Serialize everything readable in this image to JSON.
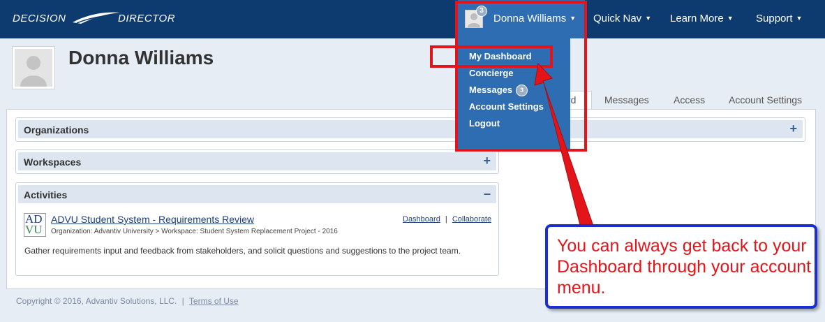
{
  "navbar": {
    "logo_left": "DECISION",
    "logo_right": "DIRECTOR",
    "user": {
      "name": "Donna Williams",
      "badge": "3"
    },
    "items": [
      {
        "label": "Quick Nav"
      },
      {
        "label": "Learn More"
      },
      {
        "label": "Support"
      }
    ]
  },
  "account_menu": {
    "items": [
      {
        "label": "My Dashboard"
      },
      {
        "label": "Concierge"
      },
      {
        "label": "Messages",
        "badge": "3"
      },
      {
        "label": "Account Settings"
      },
      {
        "label": "Logout"
      }
    ]
  },
  "profile": {
    "name": "Donna Williams"
  },
  "tabs": [
    {
      "label": "rd",
      "active": true
    },
    {
      "label": "Messages"
    },
    {
      "label": "Access"
    },
    {
      "label": "Account Settings"
    }
  ],
  "panels": {
    "organizations": {
      "title": "Organizations",
      "control": "+"
    },
    "workspaces": {
      "title": "Workspaces",
      "control": "+"
    },
    "activities": {
      "title": "Activities",
      "control": "–",
      "item": {
        "logo": [
          "AD",
          "VU"
        ],
        "title": "ADVU Student System - Requirements Review",
        "meta": "Organization: Advantiv University  >  Workspace: Student System Replacement Project - 2016",
        "links": [
          "Dashboard",
          "Collaborate"
        ],
        "separator": "|",
        "description": "Gather requirements input and feedback from stakeholders, and solicit questions and suggestions to the project team."
      }
    }
  },
  "footer": {
    "copyright": "Copyright © 2016, Advantiv Solutions, LLC.",
    "separator": "|",
    "terms": "Terms of Use"
  },
  "callout": {
    "text": "You can always get back to your Dashboard through your account menu."
  },
  "colors": {
    "navbar": "#0d3b6f",
    "menu": "#2e6db1",
    "highlight": "#e3151b",
    "callout_border": "#1b2fd0"
  },
  "icons": {
    "user_avatar": "person-silhouette-icon",
    "caret": "chevron-down-icon"
  }
}
